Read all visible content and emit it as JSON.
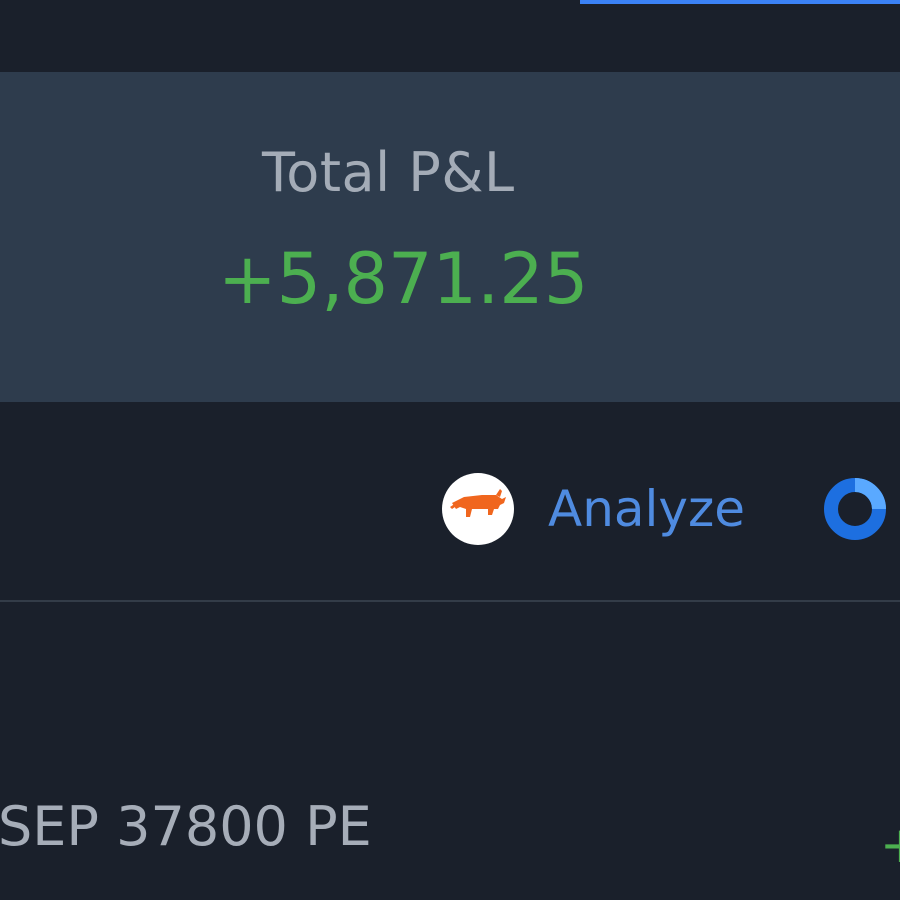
{
  "summary": {
    "total_pnl_label": "Total P&L",
    "total_pnl_value": "+5,871.25"
  },
  "toolbar": {
    "logo_icon": "bull-icon",
    "analyze_label": "Analyze",
    "status_icon": "ring-icon"
  },
  "positions": [
    {
      "instrument": "SEP 37800 PE",
      "pnl_partial": "+"
    }
  ],
  "colors": {
    "background": "#1a202b",
    "panel": "#2e3c4d",
    "profit": "#4caf50",
    "link": "#4f8be0",
    "accent": "#3b82f6",
    "logo_orange": "#f0661e"
  }
}
